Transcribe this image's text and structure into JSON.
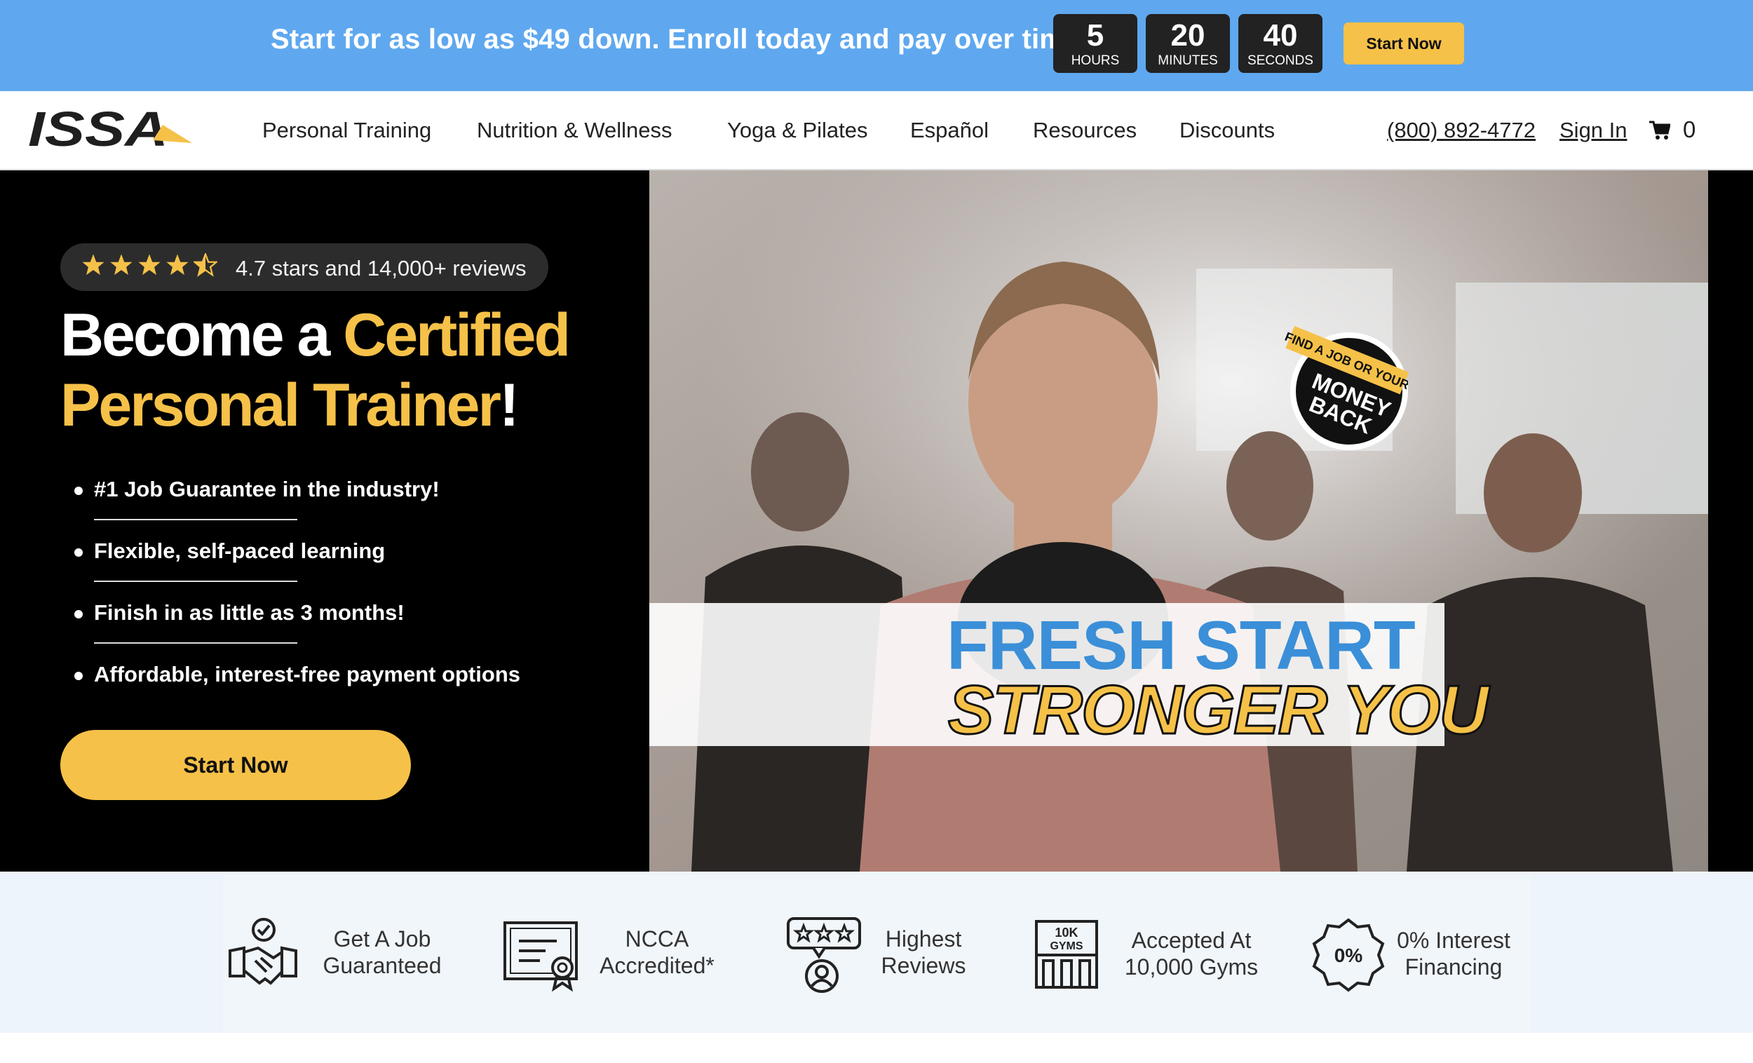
{
  "promo": {
    "text": "Start for as low as $49 down. Enroll today and pay over time.",
    "countdown": [
      {
        "value": "5",
        "label": "HOURS"
      },
      {
        "value": "20",
        "label": "MINUTES"
      },
      {
        "value": "40",
        "label": "SECONDS"
      }
    ],
    "button": "Start Now"
  },
  "nav": {
    "logo_text": "ISSA",
    "items": [
      "Personal Training",
      "Nutrition & Wellness",
      "Yoga & Pilates",
      "Español",
      "Resources",
      "Discounts"
    ],
    "phone": "(800) 892-4772",
    "sign_in": "Sign In",
    "cart_count": "0"
  },
  "hero": {
    "rating": {
      "stars": 4.5,
      "text": "4.7 stars and 14,000+ reviews"
    },
    "headline": {
      "part1": "Become a ",
      "highlight1": "Certified",
      "highlight2": "Personal Trainer",
      "end": "!"
    },
    "bullets": [
      "#1 Job Guarantee in the industry!",
      "Flexible, self-paced learning",
      "Finish in as little as 3 months!",
      "Affordable, interest-free payment options"
    ],
    "button": "Start Now",
    "image": {
      "badge_line1": "FIND A JOB OR YOUR",
      "badge_line2": "MONEY",
      "badge_line3": "BACK",
      "banner_line1": "FRESH START",
      "banner_line2": "STRONGER YOU"
    }
  },
  "features": [
    {
      "icon": "handshake-icon",
      "line1": "Get A Job",
      "line2": "Guaranteed"
    },
    {
      "icon": "certificate-icon",
      "line1": "NCCA",
      "line2": "Accredited*"
    },
    {
      "icon": "reviews-icon",
      "line1": "Highest",
      "line2": "Reviews"
    },
    {
      "icon": "gyms-icon",
      "line1": "Accepted At",
      "line2": "10,000 Gyms",
      "icon_text1": "10K",
      "icon_text2": "GYMS"
    },
    {
      "icon": "percent-badge-icon",
      "line1": "0% Interest",
      "line2": "Financing",
      "icon_text1": "0%"
    }
  ],
  "colors": {
    "promo_bg": "#5fa8ef",
    "accent_yellow": "#f5c148",
    "hero_bg": "#000000",
    "banner_blue": "#3a8fd8"
  }
}
